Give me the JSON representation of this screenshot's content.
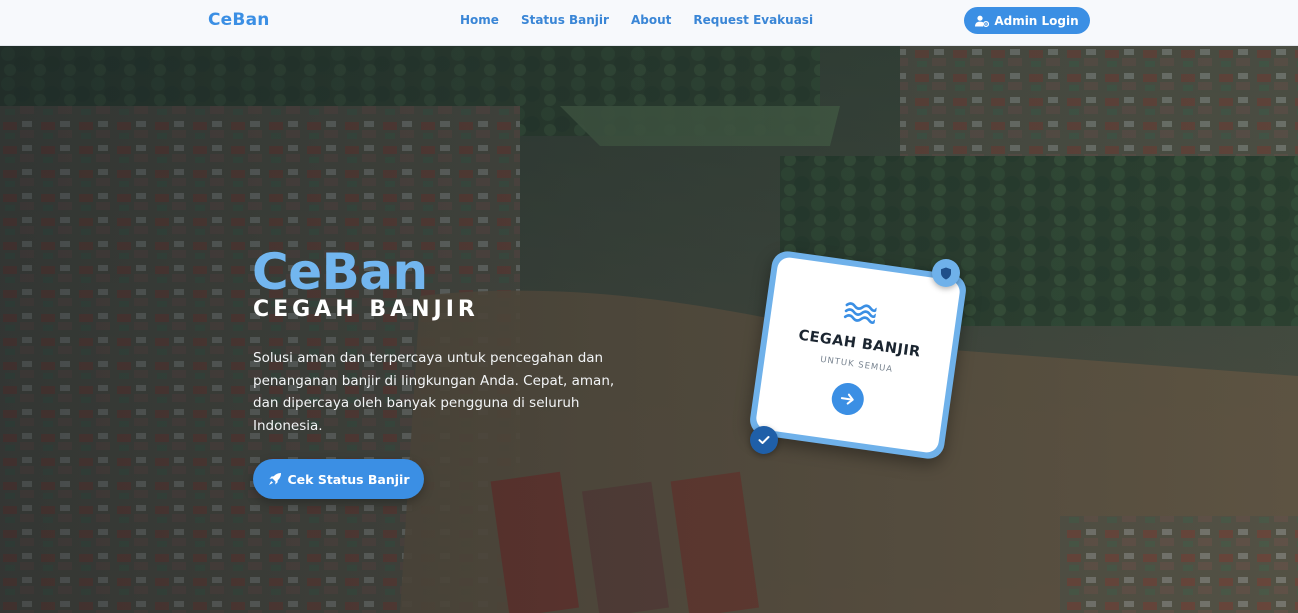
{
  "navbar": {
    "brand": "CeBan",
    "links": [
      {
        "label": "Home"
      },
      {
        "label": "Status Banjir"
      },
      {
        "label": "About"
      },
      {
        "label": "Request Evakuasi"
      }
    ],
    "admin_button": {
      "label": "Admin Login",
      "icon": "user-cog-icon"
    }
  },
  "hero": {
    "title": "CeBan",
    "subtitle": "CEGAH BANJIR",
    "description": "Solusi aman dan terpercaya untuk pencegahan dan penanganan banjir di lingkungan Anda. Cepat, aman, dan dipercaya oleh banyak pengguna di seluruh Indonesia.",
    "cta_button": {
      "label": "Cek Status Banjir",
      "icon": "rocket-icon"
    }
  },
  "card": {
    "icon": "water-wave-icon",
    "title": "CEGAH BANJIR",
    "subtitle": "UNTUK SEMUA",
    "arrow_icon": "arrow-right-icon",
    "badge_top_icon": "shield-icon",
    "badge_bottom_icon": "check-icon"
  },
  "colors": {
    "accent": "#3b8fe4",
    "title_blue": "#72b6ef",
    "navbar_bg": "#f7f9fc",
    "card_frame": "#6fb1ea",
    "badge_dark": "#1f5fa8"
  }
}
